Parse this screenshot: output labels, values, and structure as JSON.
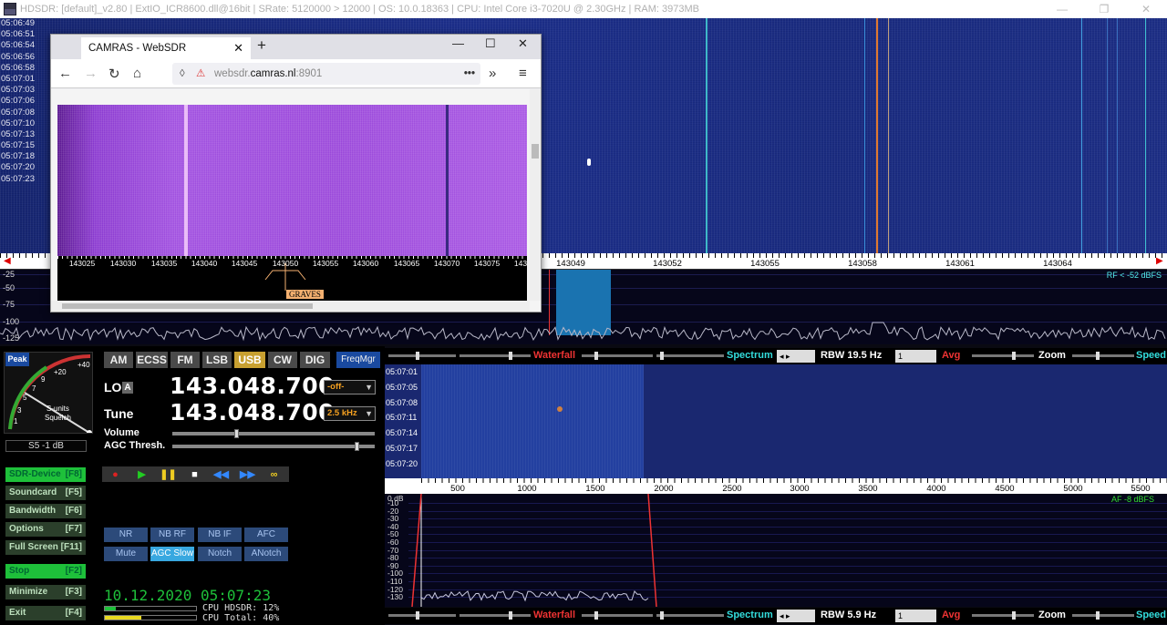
{
  "titlebar": {
    "title": "HDSDR: [default]_v2.80  |  ExtIO_ICR8600.dll@16bit  |  SRate: 5120000 > 12000  |  OS: 10.0.18363  |  CPU: Intel Core i3-7020U @ 2.30GHz  |  RAM: 3973MB",
    "restore_icon": "restore-icon",
    "close_icon": "close-icon"
  },
  "main_waterfall": {
    "times": [
      "05:06:49",
      "05:06:51",
      "05:06:54",
      "05:06:56",
      "05:06:58",
      "05:07:01",
      "05:07:03",
      "05:07:06",
      "05:07:08",
      "05:07:10",
      "05:07:13",
      "05:07:15",
      "05:07:18",
      "05:07:20",
      "05:07:23"
    ]
  },
  "main_scale": {
    "labels": [
      "143049",
      "143052",
      "143055",
      "143058",
      "143061",
      "143064"
    ]
  },
  "main_spectrum": {
    "db_labels": [
      "-25",
      "-50",
      "-75",
      "-100",
      "-125"
    ],
    "rf_level": "RF < -52 dBFS"
  },
  "meter": {
    "peak_label": "Peak",
    "scale_labels": [
      "+40",
      "+20",
      "9",
      "7",
      "5",
      "3",
      "1"
    ],
    "units": "S-units",
    "squelch": "Squelch",
    "value": "S5 -1 dB"
  },
  "modes": [
    "AM",
    "ECSS",
    "FM",
    "LSB",
    "USB",
    "CW",
    "DIG"
  ],
  "active_mode": "USB",
  "freqmgr": "FreqMgr",
  "lo": {
    "label": "LO",
    "a_label": "A",
    "value": "143.048.700",
    "dropdown": "-off-"
  },
  "tune": {
    "label": "Tune",
    "value": "143.048.700",
    "dropdown": "2.5 kHz"
  },
  "volume_label": "Volume",
  "agc_label": "AGC Thresh.",
  "side_buttons": [
    {
      "label": "SDR-Device",
      "key": "[F8]"
    },
    {
      "label": "Soundcard",
      "key": "[F5]"
    },
    {
      "label": "Bandwidth",
      "key": "[F6]"
    },
    {
      "label": "Options",
      "key": "[F7]"
    },
    {
      "label": "Full Screen",
      "key": "[F11]"
    },
    {
      "label": "Stop",
      "key": "[F2]"
    },
    {
      "label": "Minimize",
      "key": "[F3]"
    },
    {
      "label": "Exit",
      "key": "[F4]"
    }
  ],
  "dsp": {
    "nr": "NR",
    "nbrf": "NB RF",
    "nbif": "NB IF",
    "afc": "AFC",
    "mute": "Mute",
    "agc": "AGC Slow",
    "notch": "Notch",
    "anotch": "ANotch"
  },
  "status": {
    "clock": "10.12.2020 05:07:23",
    "cpu_hdsdr": "CPU HDSDR: 12%",
    "cpu_total": "CPU Total: 40%",
    "cpu_hdsdr_fraction": 0.12,
    "cpu_total_fraction": 0.4
  },
  "strip_top": {
    "waterfall": "Waterfall",
    "spectrum": "Spectrum",
    "rbw": "RBW 19.5 Hz",
    "avg_value": "1",
    "avg": "Avg",
    "zoom": "Zoom",
    "speed": "Speed"
  },
  "strip_bottom": {
    "waterfall": "Waterfall",
    "spectrum": "Spectrum",
    "rbw": "RBW  5.9 Hz",
    "avg_value": "1",
    "avg": "Avg",
    "zoom": "Zoom",
    "speed": "Speed"
  },
  "audio_waterfall": {
    "times": [
      "05:07:01",
      "05:07:05",
      "05:07:08",
      "05:07:11",
      "05:07:14",
      "05:07:17",
      "05:07:20"
    ]
  },
  "audio_scale": {
    "labels": [
      "500",
      "1000",
      "1500",
      "2000",
      "2500",
      "3000",
      "3500",
      "4000",
      "4500",
      "5000",
      "5500"
    ]
  },
  "audio_spectrum": {
    "top_label": "0 dB",
    "db_labels": [
      "-10",
      "-20",
      "-30",
      "-40",
      "-50",
      "-60",
      "-70",
      "-80",
      "-90",
      "-100",
      "-110",
      "-120",
      "-130"
    ],
    "af_level": "AF -8 dBFS"
  },
  "browser": {
    "tab_title": "CAMRAS - WebSDR",
    "url_prefix": "websdr.",
    "url_host": "camras.nl",
    "url_suffix": ":8901",
    "scale_labels": [
      "143025",
      "143030",
      "143035",
      "143040",
      "143045",
      "143050",
      "143055",
      "143060",
      "143065",
      "143070",
      "143075",
      "143"
    ],
    "graves": "GRAVES"
  }
}
